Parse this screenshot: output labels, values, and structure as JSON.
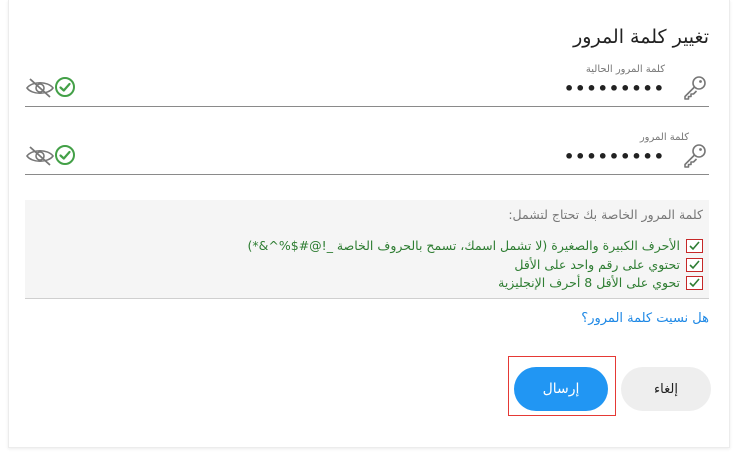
{
  "dialog": {
    "title": "تغيير كلمة المرور"
  },
  "fields": {
    "current": {
      "label": "كلمة المرور الحالية",
      "value": "•••••••••"
    },
    "new": {
      "label": "كلمة المرور",
      "value": "•••••••••"
    }
  },
  "rules": {
    "title": "كلمة المرور الخاصة بك تحتاج لتشمل:",
    "items": [
      {
        "text": "الأحرف الكبيرة والصغيرة (لا تشمل اسمك، تسمح بالحروف الخاصة _!@#$%^&*)"
      },
      {
        "text": "تحتوي على رقم واحد على الأقل"
      },
      {
        "text": "تحوي على الأقل 8 أحرف الإنجليزية"
      }
    ]
  },
  "links": {
    "forgot": "هل نسيت كلمة المرور؟"
  },
  "buttons": {
    "submit": "إرسال",
    "cancel": "إلغاء"
  },
  "colors": {
    "accent": "#2196f3",
    "success": "#2e7d32",
    "highlight": "#e53935",
    "link": "#1e88e5"
  }
}
